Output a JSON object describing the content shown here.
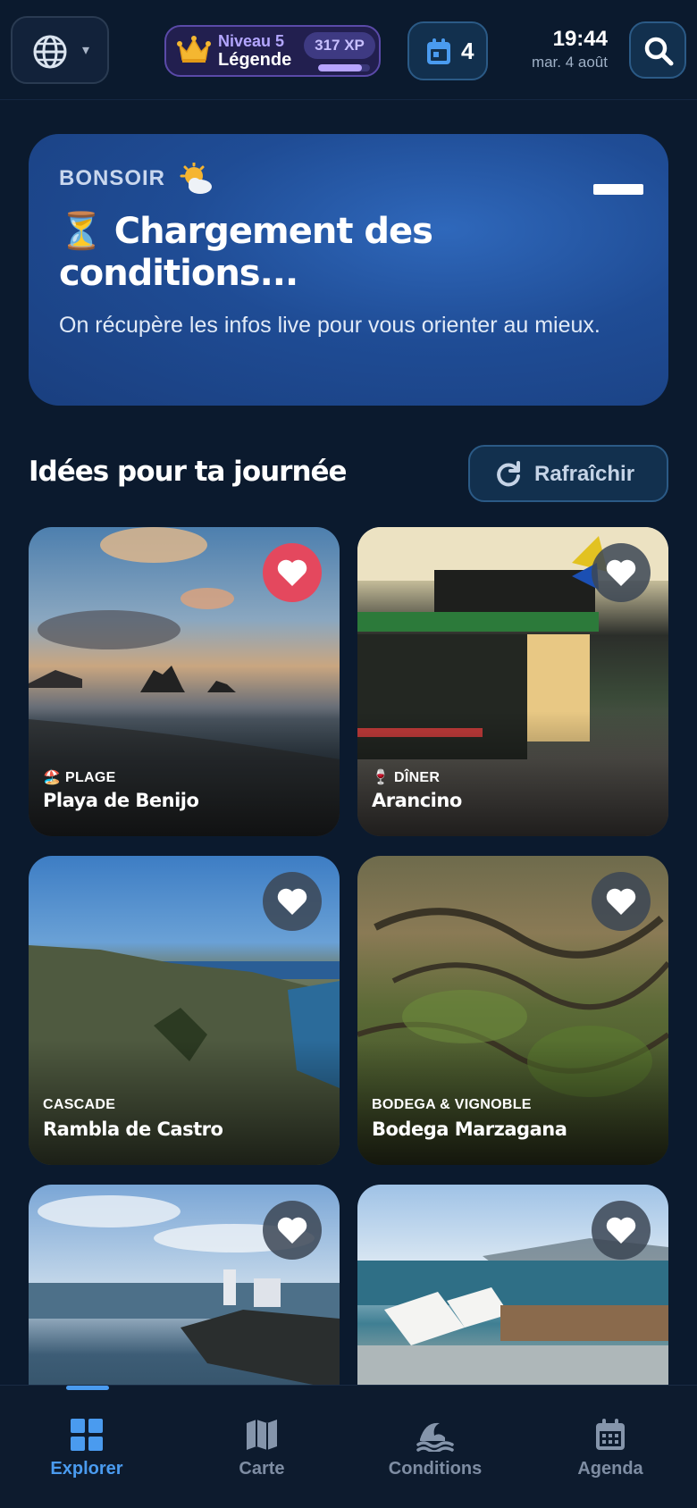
{
  "topbar": {
    "language_caret": "▾",
    "level_label": "Niveau 5",
    "level_name": "Légende",
    "xp": "317 XP",
    "xp_progress": 0.85,
    "calendar_count": "4",
    "time": "19:44",
    "date": "mar. 4 août"
  },
  "hero": {
    "greeting": "BONSOIR",
    "greeting_icon": "sun-behind-cloud-icon",
    "title": "⏳ Chargement des conditions...",
    "subtitle": "On récupère les infos live pour vous orienter au mieux."
  },
  "section": {
    "title": "Idées pour ta journée",
    "refresh_label": "Rafraîchir"
  },
  "cards": [
    {
      "category": "🏖️ PLAGE",
      "name": "Playa de Benijo",
      "favorite": true
    },
    {
      "category": "🍷 DÎNER",
      "name": "Arancino",
      "favorite": false
    },
    {
      "category": "CASCADE",
      "name": "Rambla de Castro",
      "favorite": false
    },
    {
      "category": "BODEGA & VIGNOBLE",
      "name": "Bodega Marzagana",
      "favorite": false
    },
    {
      "category": "",
      "name": "",
      "favorite": false
    },
    {
      "category": "",
      "name": "",
      "favorite": false
    }
  ],
  "nav": [
    {
      "label": "Explorer",
      "icon": "grid-icon",
      "active": true
    },
    {
      "label": "Carte",
      "icon": "map-icon",
      "active": false
    },
    {
      "label": "Conditions",
      "icon": "waves-icon",
      "active": false
    },
    {
      "label": "Agenda",
      "icon": "calendar-icon",
      "active": false
    }
  ],
  "colors": {
    "background": "#0b1a2e",
    "accent": "#4a9bef",
    "favorite_active": "#e4485e",
    "hero": "#1f4c95"
  }
}
